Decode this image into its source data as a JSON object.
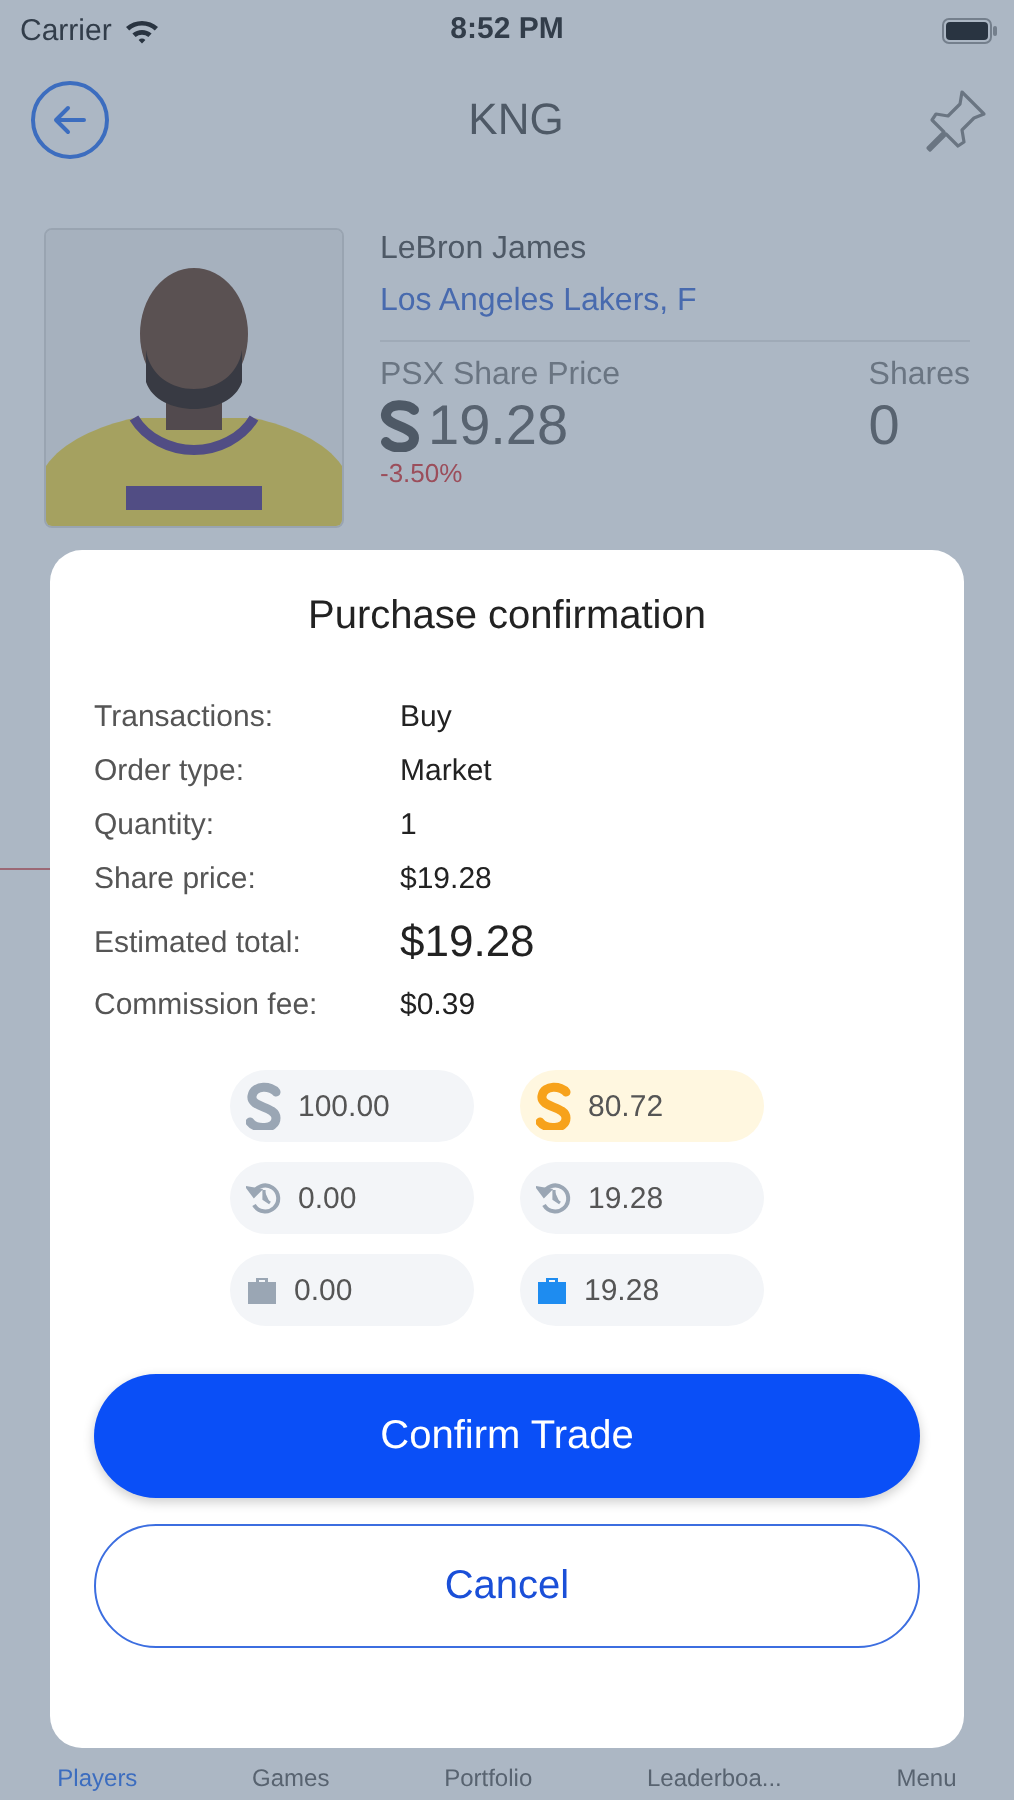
{
  "status_bar": {
    "carrier": "Carrier",
    "time": "8:52 PM"
  },
  "header": {
    "title": "KNG"
  },
  "player": {
    "name": "LeBron James",
    "team": "Los Angeles Lakers, F",
    "price_label": "PSX Share Price",
    "price": "19.28",
    "change": "-3.50%",
    "shares_label": "Shares",
    "shares": "0"
  },
  "dialog": {
    "title": "Purchase confirmation",
    "details": [
      {
        "label": "Transactions:",
        "value": "Buy",
        "kind": "normal"
      },
      {
        "label": "Order type:",
        "value": "Market",
        "kind": "normal"
      },
      {
        "label": "Quantity:",
        "value": "1",
        "kind": "normal"
      },
      {
        "label": "Share price:",
        "value": "$19.28",
        "kind": "normal"
      },
      {
        "label": "Estimated total:",
        "value": "$19.28",
        "kind": "large"
      },
      {
        "label": "Commission fee:",
        "value": "$0.39",
        "kind": "normal"
      }
    ],
    "balances": [
      {
        "kind": "coin",
        "value": "100.00",
        "highlighted": false,
        "color": "#9aa6b4"
      },
      {
        "kind": "coin",
        "value": "80.72",
        "highlighted": true,
        "color": "#f7a21b"
      },
      {
        "kind": "history",
        "value": "0.00",
        "highlighted": false,
        "color": "#9aa6b4"
      },
      {
        "kind": "history",
        "value": "19.28",
        "highlighted": false,
        "color": "#9aa6b4"
      },
      {
        "kind": "briefcase",
        "value": "0.00",
        "highlighted": false,
        "color": "#9aa6b4"
      },
      {
        "kind": "briefcase",
        "value": "19.28",
        "highlighted": false,
        "color": "#1e8cf0"
      }
    ],
    "buttons": [
      {
        "label": "Confirm Trade",
        "kind": "primary"
      },
      {
        "label": "Cancel",
        "kind": "secondary"
      }
    ]
  },
  "tab_bar": {
    "items": [
      "Players",
      "Games",
      "Portfolio",
      "Leaderboa...",
      "Menu"
    ]
  }
}
